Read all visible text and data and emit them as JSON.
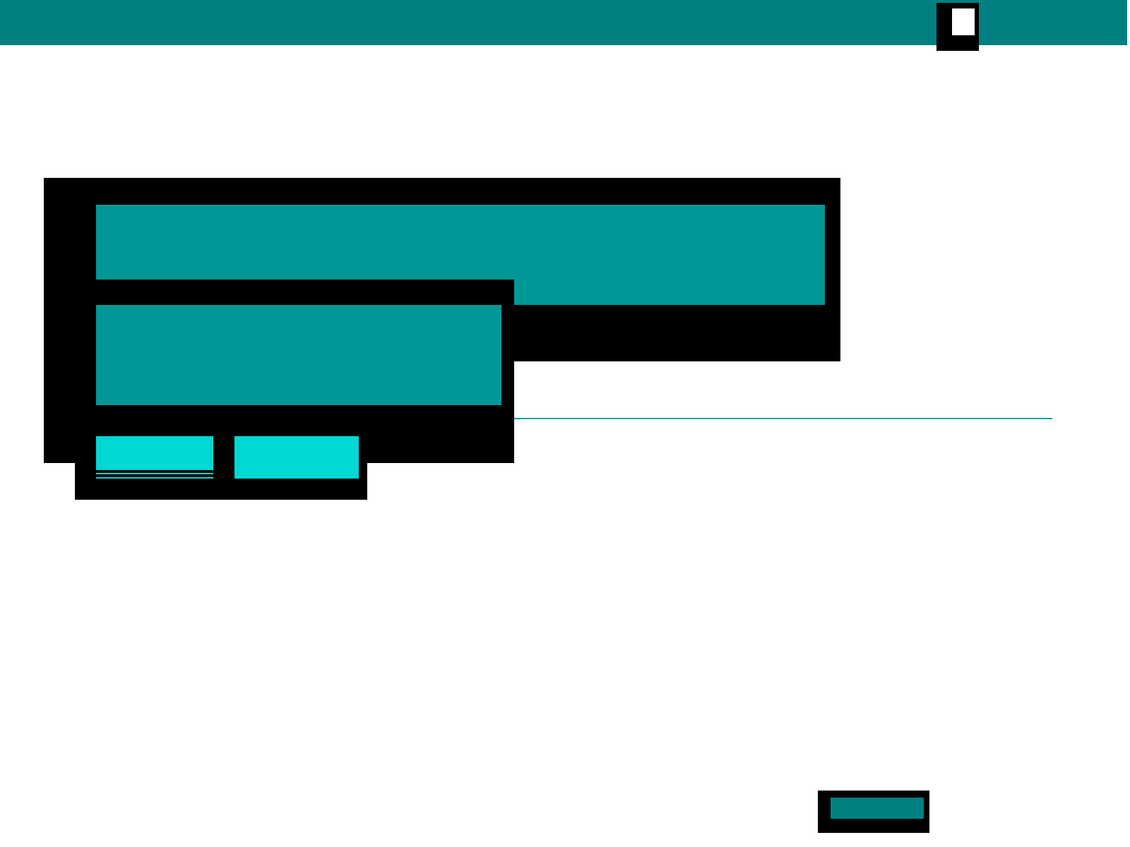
{
  "buttons": [
    {
      "selected": true
    },
    {
      "selected": false
    }
  ]
}
